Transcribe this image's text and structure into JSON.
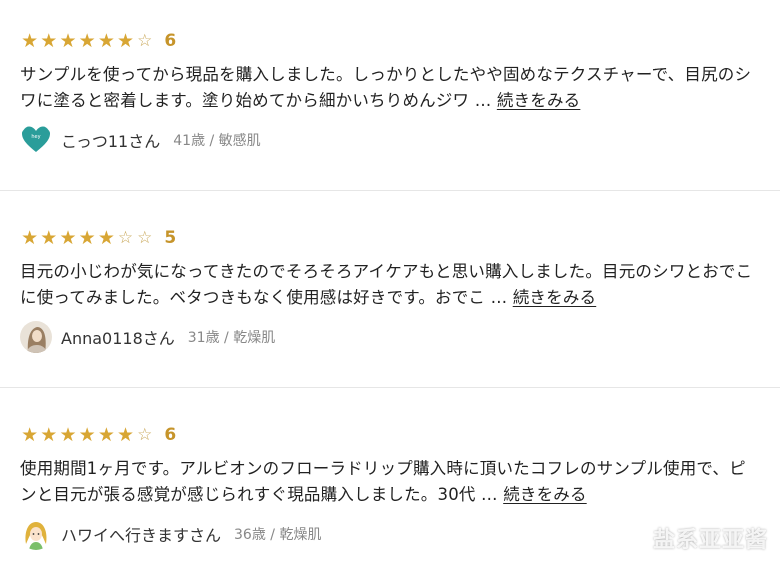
{
  "reviews": [
    {
      "stars_filled": 6,
      "stars_total": 7,
      "score": "6",
      "text": "サンプルを使ってから現品を購入しました。しっかりとしたやや固めなテクスチャーで、目尻のシワに塗ると密着します。塗り始めてから細かいちりめんジワ … ",
      "more_label": "続きをみる",
      "author": "こっつ11さん",
      "meta": "41歳 / 敏感肌",
      "avatar": "teal-heart-avatar"
    },
    {
      "stars_filled": 5,
      "stars_total": 7,
      "score": "5",
      "text": "目元の小じわが気になってきたのでそろそろアイケアもと思い購入しました。目元のシワとおでこに使ってみました。ベタつきもなく使用感は好きです。おでこ … ",
      "more_label": "続きをみる",
      "author": "Anna0118さん",
      "meta": "31歳 / 乾燥肌",
      "avatar": "woman-photo-avatar"
    },
    {
      "stars_filled": 6,
      "stars_total": 7,
      "score": "6",
      "text": "使用期間1ヶ月です。アルビオンのフローラドリップ購入時に頂いたコフレのサンプル使用で、ピンと目元が張る感覚が感じられすぐ現品購入しました。30代 … ",
      "more_label": "続きをみる",
      "author": "ハワイへ行きますさん",
      "meta": "36歳 / 乾燥肌",
      "avatar": "girl-illustration-avatar"
    }
  ],
  "colors": {
    "star": "#d8a634",
    "score": "#c6942a",
    "divider": "#e6e6e6"
  },
  "watermark": "盐系亚亚酱"
}
